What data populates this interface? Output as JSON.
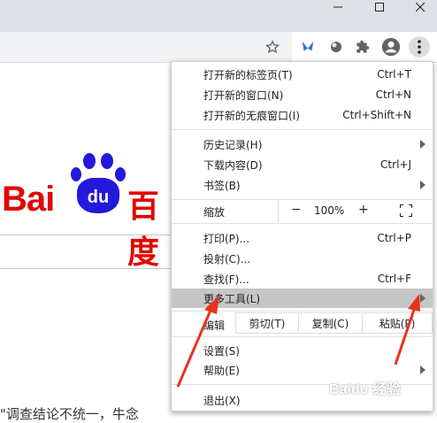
{
  "menu": {
    "group1": [
      {
        "label": "打开新的标签页(T)",
        "shortcut": "Ctrl+T"
      },
      {
        "label": "打开新的窗口(N)",
        "shortcut": "Ctrl+N"
      },
      {
        "label": "打开新的无痕窗口(I)",
        "shortcut": "Ctrl+Shift+N"
      }
    ],
    "group2": [
      {
        "label": "历史记录(H)",
        "shortcut": ""
      },
      {
        "label": "下载内容(D)",
        "shortcut": "Ctrl+J"
      },
      {
        "label": "书签(B)",
        "shortcut": ""
      }
    ],
    "zoom": {
      "label": "缩放",
      "minus": "−",
      "value": "100%",
      "plus": "+"
    },
    "group3": [
      {
        "label": "打印(P)...",
        "shortcut": "Ctrl+P"
      },
      {
        "label": "投射(C)...",
        "shortcut": ""
      },
      {
        "label": "查找(F)...",
        "shortcut": "Ctrl+F"
      },
      {
        "label": "更多工具(L)",
        "shortcut": ""
      }
    ],
    "edit": {
      "label": "编辑",
      "cut": "剪切(T)",
      "copy": "复制(C)",
      "paste": "粘贴(P)"
    },
    "group4": [
      {
        "label": "设置(S)"
      },
      {
        "label": "帮助(E)"
      }
    ],
    "exit": {
      "label": "退出(X)"
    }
  },
  "page": {
    "logo_latin": "Bai",
    "logo_du": "du",
    "logo_cn": "百度",
    "snippet": "\"调查结论不统一，牛念"
  },
  "watermark": "Baidu 经验",
  "colors": {
    "hover": "#c6c6c6",
    "arrow": "#e8321e",
    "logo_red": "#e10601",
    "logo_blue": "#2319dc"
  }
}
